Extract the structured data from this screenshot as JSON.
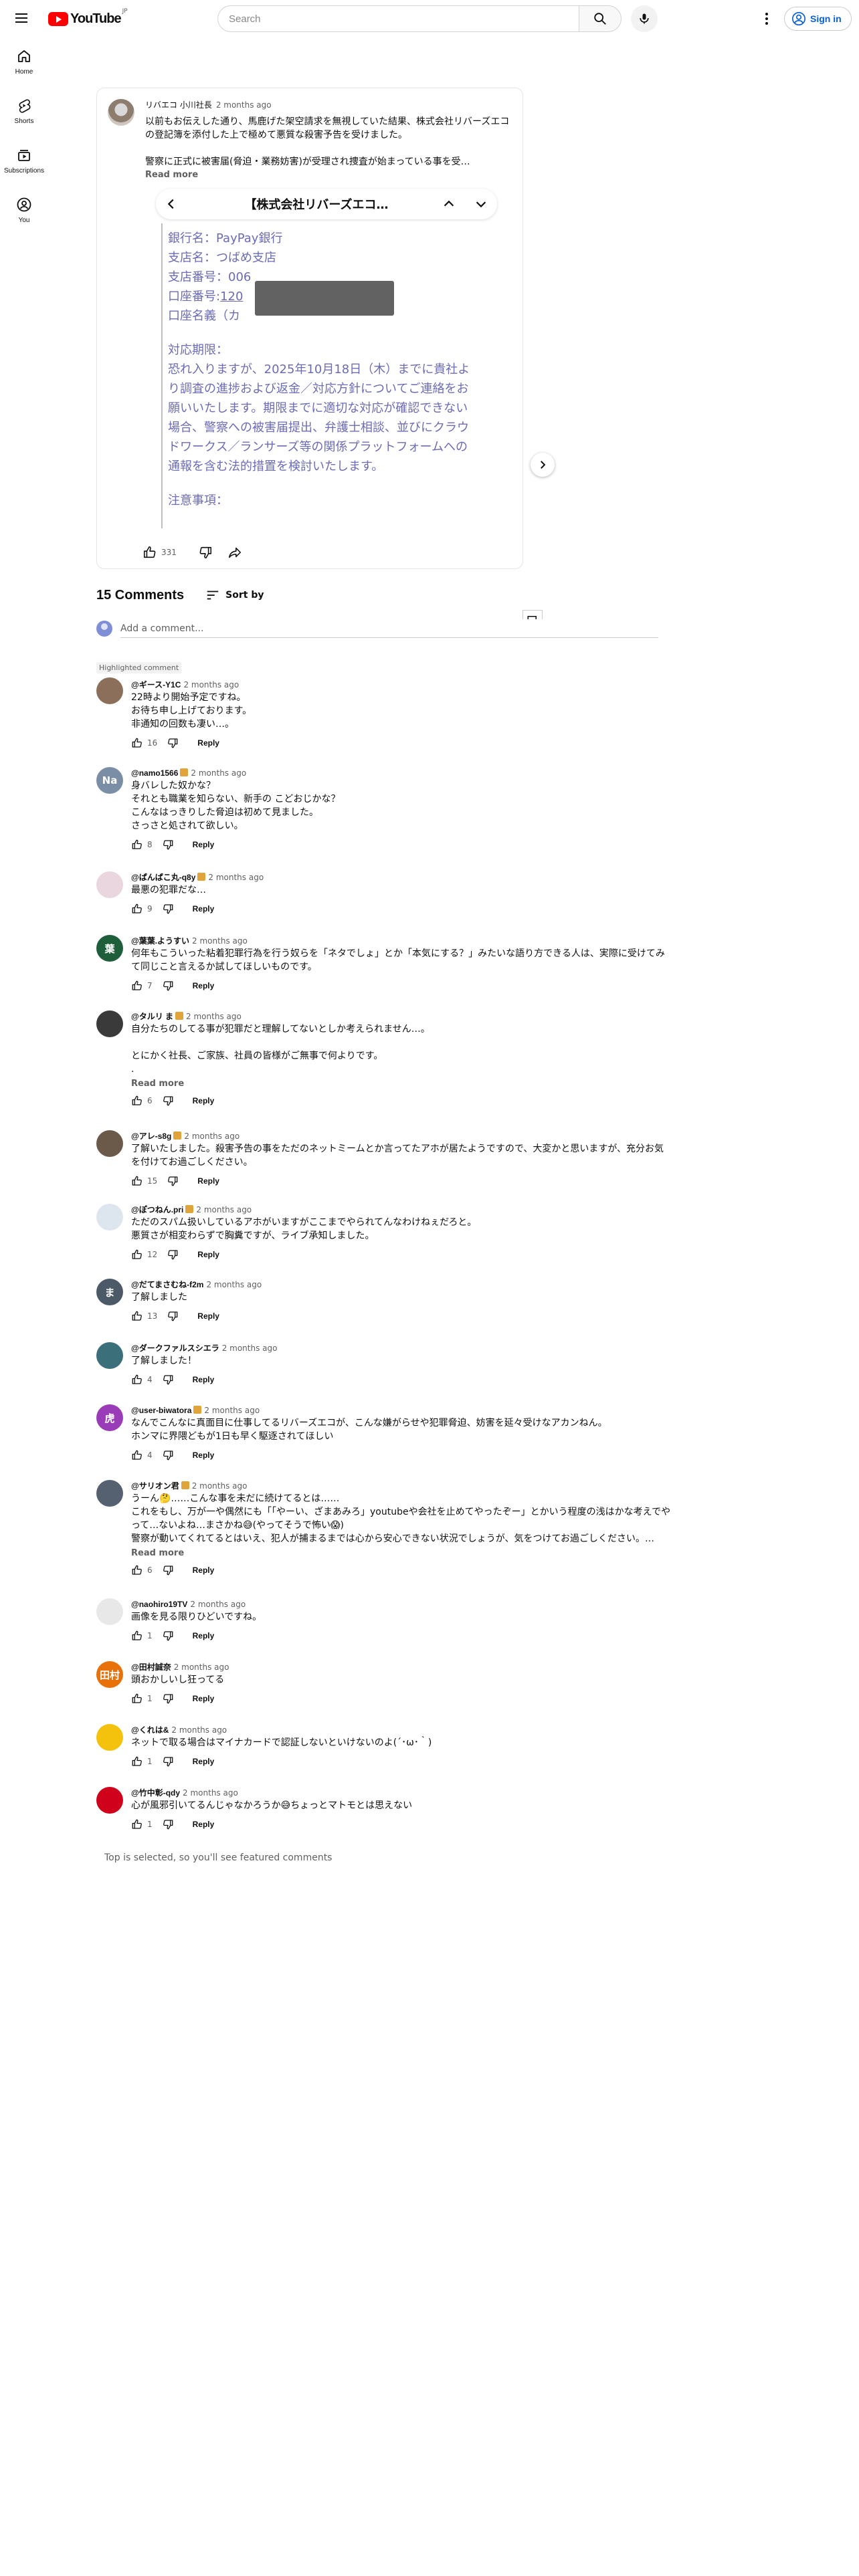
{
  "header": {
    "logo_text": "YouTube",
    "logo_country": "JP",
    "search_placeholder": "Search",
    "signin_label": "Sign in"
  },
  "sidebar": {
    "items": [
      {
        "label": "Home",
        "icon": "home-icon"
      },
      {
        "label": "Shorts",
        "icon": "shorts-icon"
      },
      {
        "label": "Subscriptions",
        "icon": "subscriptions-icon"
      },
      {
        "label": "You",
        "icon": "you-icon"
      }
    ]
  },
  "post": {
    "author": "リバエコ 小川社長",
    "time": "2 months ago",
    "text1": "以前もお伝えした通り、馬鹿げた架空請求を無視していた結果、株式会社リバーズエコの登記簿を添付した上で極めて悪質な殺害予告を受けました。",
    "text2": "警察に正式に被害届(脅迫・業務妨害)が受理され捜査が始まっている事を受…",
    "read_more": "Read more",
    "likes": "331",
    "doc": {
      "title": "【株式会社リバーズエコ…",
      "bank": "銀行名：PayPay銀行",
      "branch": "支店名：つばめ支店",
      "branch_no": "支店番号：006",
      "account_label": "口座番号:",
      "account_visible": "120",
      "holder": "口座名義（カ",
      "deadline_heading": "対応期限：",
      "deadline_text": "恐れ入りますが、2025年10月18日（木）までに貴社より調査の進捗および返金／対応方針についてご連絡をお願いいたします。期限までに適切な対応が確認できない場合、警察への被害届提出、弁護士相談、並びにクラウドワークス／ランサーズ等の関係プラットフォームへの通報を含む法的措置を検討いたします。",
      "notes_heading": "注意事項："
    }
  },
  "comments_section": {
    "count_label": "15 Comments",
    "sort_label": "Sort by",
    "add_placeholder": "Add a comment...",
    "highlighted_label": "Highlighted comment",
    "footer_note": "Top is selected, so you'll see featured comments"
  },
  "comments": [
    {
      "handle": "@ギース-Y1C",
      "member": false,
      "time": "2 months ago",
      "text": "22時より開始予定ですね。\nお待ち申し上げております。\n非通知の回数も凄い…。",
      "likes": "16",
      "avatar_color": "#8b6f5a",
      "avatar_text": ""
    },
    {
      "handle": "@namo1566",
      "member": true,
      "time": "2 months ago",
      "text": "身バレした奴かな？\nそれとも職業を知らない、新手の こどおじかな？\nこんなはっきりした脅迫は初めて見ました。\nさっさと処されて欲しい。",
      "likes": "8",
      "avatar_color": "#7a8fa6",
      "avatar_text": "Na"
    },
    {
      "handle": "@ぱんぱこ丸-q8y",
      "member": true,
      "time": "2 months ago",
      "text": "最悪の犯罪だな…",
      "likes": "9",
      "avatar_color": "#e9d6de",
      "avatar_text": ""
    },
    {
      "handle": "@葉葉.ようすい",
      "member": false,
      "time": "2 months ago",
      "text": "何年もこういった粘着犯罪行為を行う奴らを「ネタでしょ」とか「本気にする？」みたいな語り方できる人は、実際に受けてみて同じこと言えるか試してほしいものです。",
      "likes": "7",
      "avatar_color": "#1f5e3b",
      "avatar_text": "葉"
    },
    {
      "handle": "@タルリ ま",
      "member": true,
      "time": "2 months ago",
      "text": "自分たちのしてる事が犯罪だと理解してないとしか考えられません…。\n\nとにかく社長、ご家族、社員の皆様がご無事で何よりです。\n.",
      "read_more": "Read more",
      "likes": "6",
      "avatar_color": "#3a3a3a",
      "avatar_text": ""
    },
    {
      "handle": "@アレ-s8g",
      "member": true,
      "time": "2 months ago",
      "text": "了解いたしました。殺害予告の事をただのネットミームとか言ってたアホが居たようですので、大変かと思いますが、充分お気を付けてお過ごしください。",
      "likes": "15",
      "avatar_color": "#6b5a4a",
      "avatar_text": ""
    },
    {
      "handle": "@ぽつねん.pri",
      "member": true,
      "time": "2 months ago",
      "text": "ただのスパム扱いしているアホがいますがここまでやられてんなわけねぇだろと。\n悪質さが相変わらずで胸糞ですが、ライブ承知しました。",
      "likes": "12",
      "avatar_color": "#dde6ee",
      "avatar_text": ""
    },
    {
      "handle": "@だてまさむね-f2m",
      "member": false,
      "time": "2 months ago",
      "text": "了解しました",
      "likes": "13",
      "avatar_color": "#4b5a66",
      "avatar_text": "ま"
    },
    {
      "handle": "@ダークファルスシエラ",
      "member": false,
      "time": "2 months ago",
      "text": "了解しました！",
      "likes": "4",
      "avatar_color": "#3b6f7a",
      "avatar_text": ""
    },
    {
      "handle": "@user-biwatora",
      "member": true,
      "time": "2 months ago",
      "text": "なんでこんなに真面目に仕事してるリバーズエコが、こんな嫌がらせや犯罪脅迫、妨害を延々受けなアカンねん。\nホンマに界隈どもが1日も早く駆逐されてほしい",
      "likes": "4",
      "avatar_color": "#9a3cb8",
      "avatar_text": "虎"
    },
    {
      "handle": "@サリオン君",
      "member": true,
      "time": "2 months ago",
      "text": "うーん🤔……こんな事を未だに続けてるとは……\nこれをもし、万が一や偶然にも「「やーい、ざまあみろ」youtubeや会社を止めてやったぞー」とかいう程度の浅はかな考えでやって…ないよね…まさかね😅(やってそうで怖い😱)",
      "text_clip": "警察が動いてくれてるとはいえ、犯人が捕まるまでは心から安心できない状況でしょうが、気をつけてお過ごしください。…",
      "read_more": "Read more",
      "likes": "6",
      "avatar_color": "#556070",
      "avatar_text": ""
    },
    {
      "handle": "@naohiro19TV",
      "member": false,
      "time": "2 months ago",
      "text": "画像を見る限りひどいですね。",
      "likes": "1",
      "avatar_color": "#e8e8e8",
      "avatar_text": ""
    },
    {
      "handle": "@田村誠奈",
      "member": false,
      "time": "2 months ago",
      "text": "頭おかしいし狂ってる",
      "likes": "1",
      "avatar_color": "#e8710a",
      "avatar_text": "田村"
    },
    {
      "handle": "@くれは&",
      "member": false,
      "time": "2 months ago",
      "text": "ネットで取る場合はマイナカードで認証しないといけないのよ(´･ω･｀)",
      "likes": "1",
      "avatar_color": "#f4c20d",
      "avatar_text": ""
    },
    {
      "handle": "@竹中彰-qdy",
      "member": false,
      "time": "2 months ago",
      "text": "心が風邪引いてるんじゃなかろうか😅ちょっとマトモとは思えない",
      "likes": "1",
      "avatar_color": "#d0021b",
      "avatar_text": ""
    }
  ],
  "reply_label": "Reply"
}
